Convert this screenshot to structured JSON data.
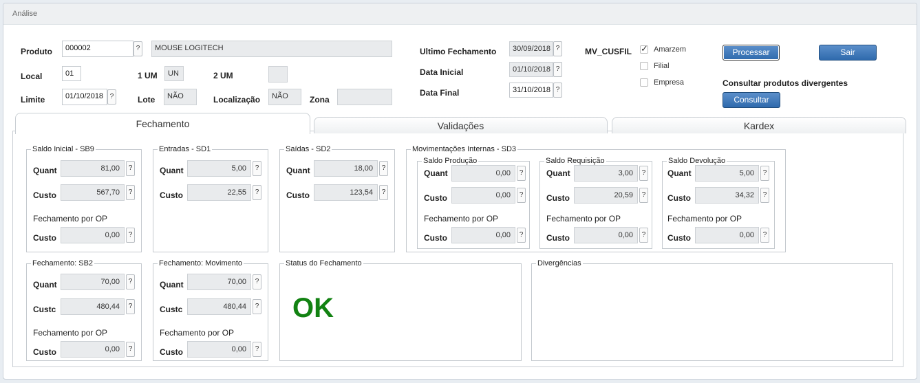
{
  "window": {
    "title": "Análise"
  },
  "header": {
    "produto": {
      "label": "Produto",
      "code": "000002",
      "desc": "MOUSE LOGITECH"
    },
    "local": {
      "label": "Local",
      "value": "01"
    },
    "um1": {
      "label": "1 UM",
      "value": "UN"
    },
    "um2": {
      "label": "2 UM",
      "value": ""
    },
    "limite": {
      "label": "Limite",
      "value": "01/10/2018"
    },
    "lote": {
      "label": "Lote",
      "value": "NÃO"
    },
    "localizacao": {
      "label": "Localização",
      "value": "NÃO"
    },
    "zona": {
      "label": "Zona",
      "value": ""
    },
    "ultimo_fechamento": {
      "label": "Ultimo Fechamento",
      "value": "30/09/2018"
    },
    "data_inicial": {
      "label": "Data Inicial",
      "value": "01/10/2018"
    },
    "data_final": {
      "label": "Data Final",
      "value": "31/10/2018"
    },
    "mv_cusfil": {
      "label": "MV_CUSFIL",
      "options": [
        {
          "label": "Amarzem",
          "checked": true
        },
        {
          "label": "Filial",
          "checked": false
        },
        {
          "label": "Empresa",
          "checked": false
        }
      ]
    },
    "processar": "Processar",
    "sair": "Sair",
    "consultar_heading": "Consultar produtos divergentes",
    "consultar": "Consultar"
  },
  "tabs": [
    "Fechamento",
    "Validações",
    "Kardex"
  ],
  "common": {
    "quant": "Quant",
    "custo": "Custo",
    "custo_trunc": "Custc",
    "fech_op": "Fechamento por OP",
    "q": "?"
  },
  "groups": {
    "saldo_inicial": {
      "title": "Saldo Inicial - SB9",
      "quant": "81,00",
      "custo": "567,70",
      "op_custo": "0,00"
    },
    "entradas": {
      "title": "Entradas - SD1",
      "quant": "5,00",
      "custo": "22,55"
    },
    "saidas": {
      "title": "Saídas - SD2",
      "quant": "18,00",
      "custo": "123,54"
    },
    "mov_internas": {
      "title": "Movimentações Internas - SD3"
    },
    "saldo_producao": {
      "title": "Saldo Produção",
      "quant": "0,00",
      "custo": "0,00",
      "op_custo": "0,00"
    },
    "saldo_requisicao": {
      "title": "Saldo Requisição",
      "quant": "3,00",
      "custo": "20,59",
      "op_custo": "0,00"
    },
    "saldo_devolucao": {
      "title": "Saldo Devolução",
      "quant": "5,00",
      "custo": "34,32",
      "op_custo": "0,00"
    },
    "fech_sb2": {
      "title": "Fechamento: SB2",
      "quant": "70,00",
      "custo": "480,44",
      "op_custo": "0,00"
    },
    "fech_mov": {
      "title": "Fechamento: Movimento",
      "quant": "70,00",
      "custo": "480,44",
      "op_custo": "0,00"
    },
    "status": {
      "title": "Status do Fechamento",
      "value": "OK"
    },
    "divergencias": {
      "title": "Divergências"
    }
  },
  "colors": {
    "ok": "#128212",
    "button": "#2f6aad"
  }
}
